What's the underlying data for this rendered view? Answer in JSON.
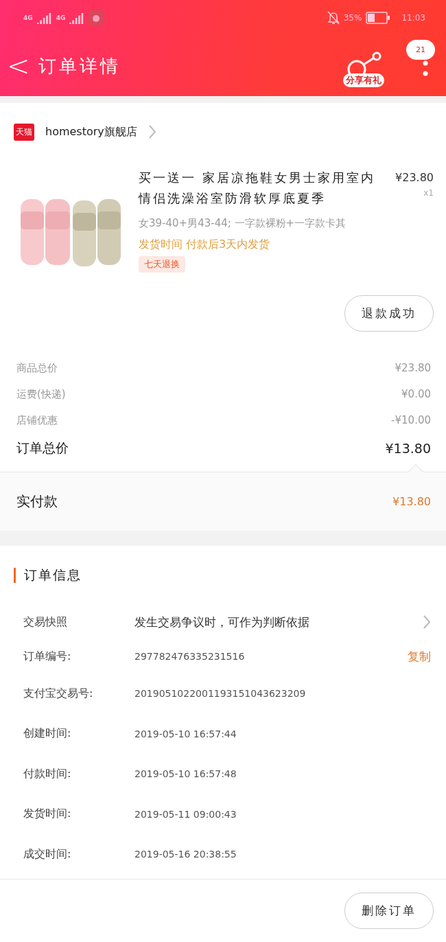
{
  "status_bar": {
    "network_1": "4G",
    "network_2": "4G",
    "battery_percent": "35%",
    "time": "11:03"
  },
  "header": {
    "back": "<",
    "title": "订单详情",
    "share_label": "分享有礼",
    "badge": "21"
  },
  "shop": {
    "logo_text": "天猫",
    "name": "homestory旗舰店"
  },
  "product": {
    "title": "买一送一 家居凉拖鞋女男士家用室内情侣洗澡浴室防滑软厚底夏季",
    "price": "¥23.80",
    "quantity": "x1",
    "spec": "女39-40+男43-44; 一字款裸粉+一字款卡其",
    "shipping": "发货时间 付款后3天内发货",
    "tag": "七天退换",
    "action": "退款成功"
  },
  "summary": [
    {
      "label": "商品总价",
      "value": "¥23.80",
      "kind": "minor"
    },
    {
      "label": "运费(快递)",
      "value": "¥0.00",
      "kind": "minor"
    },
    {
      "label": "店铺优惠",
      "value": "-¥10.00",
      "kind": "minor"
    },
    {
      "label": "订单总价",
      "value": "¥13.80",
      "kind": "total"
    }
  ],
  "paid": {
    "label": "实付款",
    "value": "¥13.80"
  },
  "order_info": {
    "title": "订单信息",
    "rows": [
      {
        "label": "交易快照",
        "value": "发生交易争议时，可作为判断依据",
        "kind": "link"
      },
      {
        "label": "订单编号:",
        "value": "297782476335231516",
        "kind": "copy",
        "action": "复制"
      },
      {
        "label": "支付宝交易号:",
        "value": "2019051022001193151043623209",
        "kind": "plain"
      },
      {
        "label": "创建时间:",
        "value": "2019-05-10 16:57:44",
        "kind": "plain"
      },
      {
        "label": "付款时间:",
        "value": "2019-05-10 16:57:48",
        "kind": "plain"
      },
      {
        "label": "发货时间:",
        "value": "2019-05-11 09:00:43",
        "kind": "plain"
      },
      {
        "label": "成交时间:",
        "value": "2019-05-16 20:38:55",
        "kind": "plain"
      }
    ]
  },
  "bottom_bar": {
    "button": "删除订单"
  }
}
